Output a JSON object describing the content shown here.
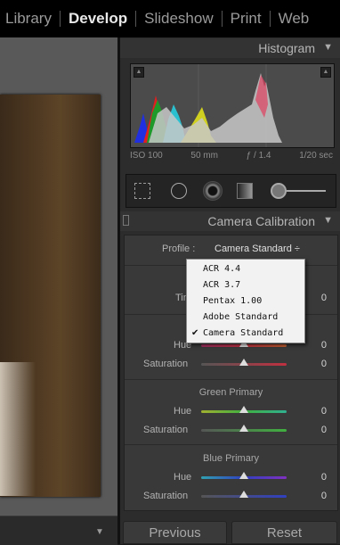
{
  "modules": [
    "Library",
    "Develop",
    "Slideshow",
    "Print",
    "Web"
  ],
  "active_module": "Develop",
  "histogram": {
    "title": "Histogram",
    "iso": "ISO 100",
    "focal": "50 mm",
    "aperture": "ƒ / 1.4",
    "shutter": "1/20 sec"
  },
  "calibration": {
    "title": "Camera Calibration",
    "profile_label": "Profile :",
    "profile_value": "Camera Standard ÷",
    "tint_label": "Tint",
    "tint_value": "0",
    "red": {
      "hue_label": "Hue",
      "hue_value": "0",
      "sat_label": "Saturation",
      "sat_value": "0"
    },
    "green": {
      "title": "Green Primary",
      "hue_label": "Hue",
      "hue_value": "0",
      "sat_label": "Saturation",
      "sat_value": "0"
    },
    "blue": {
      "title": "Blue Primary",
      "hue_label": "Hue",
      "hue_value": "0",
      "sat_label": "Saturation",
      "sat_value": "0"
    },
    "dropdown": [
      "ACR 4.4",
      "ACR 3.7",
      "Pentax 1.00",
      "Adobe Standard",
      "Camera Standard"
    ],
    "selected": "Camera Standard",
    "check_mark": "✔"
  },
  "buttons": {
    "previous": "Previous",
    "reset": "Reset"
  },
  "icons": {
    "collapse_triangle": "▼"
  }
}
